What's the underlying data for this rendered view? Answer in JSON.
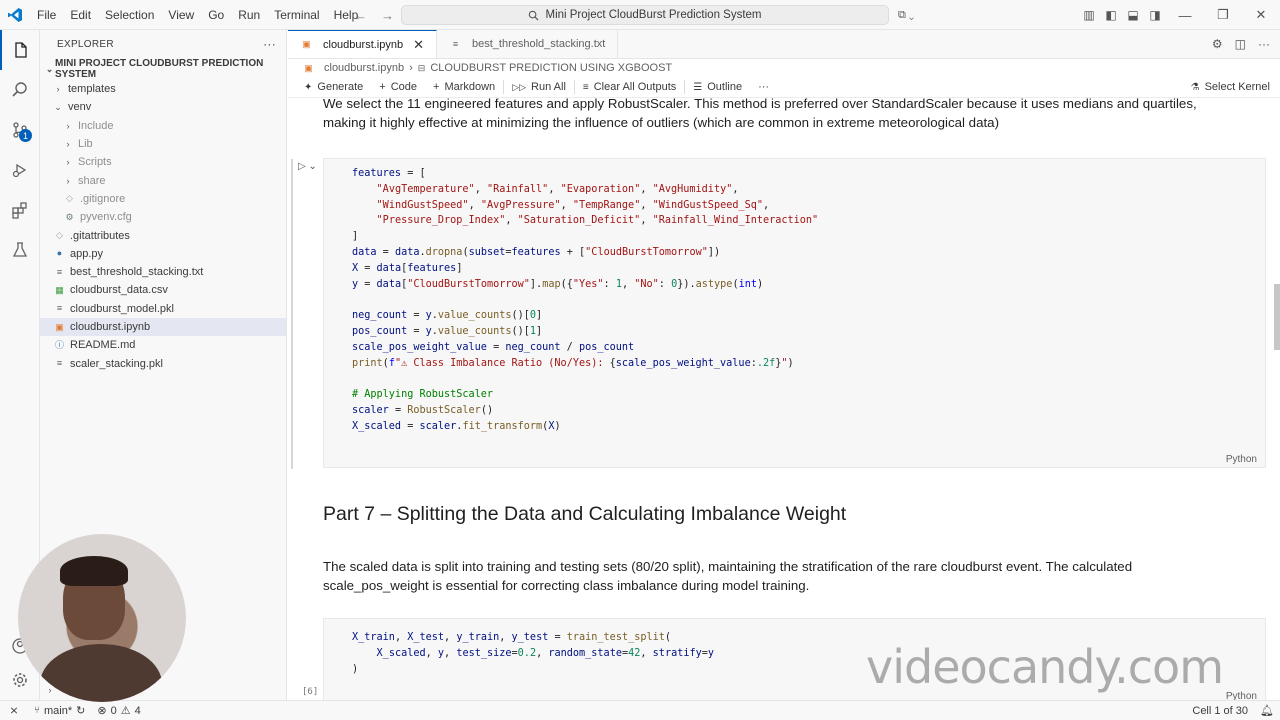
{
  "titlebar": {
    "menu": [
      "File",
      "Edit",
      "Selection",
      "View",
      "Go",
      "Run",
      "Terminal",
      "Help"
    ],
    "search_text": "Mini Project CloudBurst Prediction System"
  },
  "sidebar": {
    "header": "EXPLORER",
    "folder": "MINI PROJECT CLOUDBURST PREDICTION SYSTEM",
    "items": [
      {
        "label": "templates",
        "indent": 1,
        "type": "folder-closed"
      },
      {
        "label": "venv",
        "indent": 1,
        "type": "folder-open"
      },
      {
        "label": "Include",
        "indent": 2,
        "type": "folder-closed",
        "dim": true
      },
      {
        "label": "Lib",
        "indent": 2,
        "type": "folder-closed",
        "dim": true
      },
      {
        "label": "Scripts",
        "indent": 2,
        "type": "folder-closed",
        "dim": true
      },
      {
        "label": "share",
        "indent": 2,
        "type": "folder-closed",
        "dim": true
      },
      {
        "label": ".gitignore",
        "indent": 2,
        "type": "file",
        "dim": true
      },
      {
        "label": "pyvenv.cfg",
        "indent": 2,
        "type": "gear",
        "dim": true
      },
      {
        "label": ".gitattributes",
        "indent": 1,
        "type": "file"
      },
      {
        "label": "app.py",
        "indent": 1,
        "type": "python"
      },
      {
        "label": "best_threshold_stacking.txt",
        "indent": 1,
        "type": "text"
      },
      {
        "label": "cloudburst_data.csv",
        "indent": 1,
        "type": "csv"
      },
      {
        "label": "cloudburst_model.pkl",
        "indent": 1,
        "type": "pkl"
      },
      {
        "label": "cloudburst.ipynb",
        "indent": 1,
        "type": "notebook",
        "selected": true
      },
      {
        "label": "README.md",
        "indent": 1,
        "type": "info"
      },
      {
        "label": "scaler_stacking.pkl",
        "indent": 1,
        "type": "pkl"
      }
    ],
    "bottom_label": "TI"
  },
  "tabs": [
    {
      "label": "cloudburst.ipynb",
      "active": true
    },
    {
      "label": "best_threshold_stacking.txt",
      "active": false
    }
  ],
  "breadcrumb": {
    "file": "cloudburst.ipynb",
    "sep": "›",
    "section": "CLOUDBURST PREDICTION USING XGBOOST"
  },
  "toolbar": {
    "generate": "Generate",
    "code": "Code",
    "markdown": "Markdown",
    "run_all": "Run All",
    "clear_all": "Clear All Outputs",
    "outline": "Outline",
    "more": "···",
    "kernel": "Select Kernel"
  },
  "notebook": {
    "md1_line1": "We select the 11 engineered features and apply RobustScaler. This method is preferred over StandardScaler because it uses medians and quartiles,",
    "md1_line2": "making it highly effective at minimizing the influence of outliers (which are common in extreme meteorological data)",
    "cell1_lang": "Python",
    "heading": "Part 7 – Splitting the Data and Calculating Imbalance Weight",
    "md2_line1": "The scaled data is split into training and testing sets (80/20 split), maintaining the stratification of the rare cloudburst event. The calculated",
    "md2_line2": "scale_pos_weight is essential for correcting class imbalance during model training.",
    "cell2_exec": "[6]",
    "cell2_lang": "Python"
  },
  "statusbar": {
    "branch": "main*",
    "errors": "0",
    "warnings": "4",
    "cell_position": "Cell 1 of 30"
  },
  "overlay": {
    "watermark": "videocandy.com"
  },
  "colors": {
    "accent": "#005fb8",
    "keyword": "#0000ff",
    "string": "#a31515",
    "comment": "#008000",
    "number": "#098658"
  }
}
